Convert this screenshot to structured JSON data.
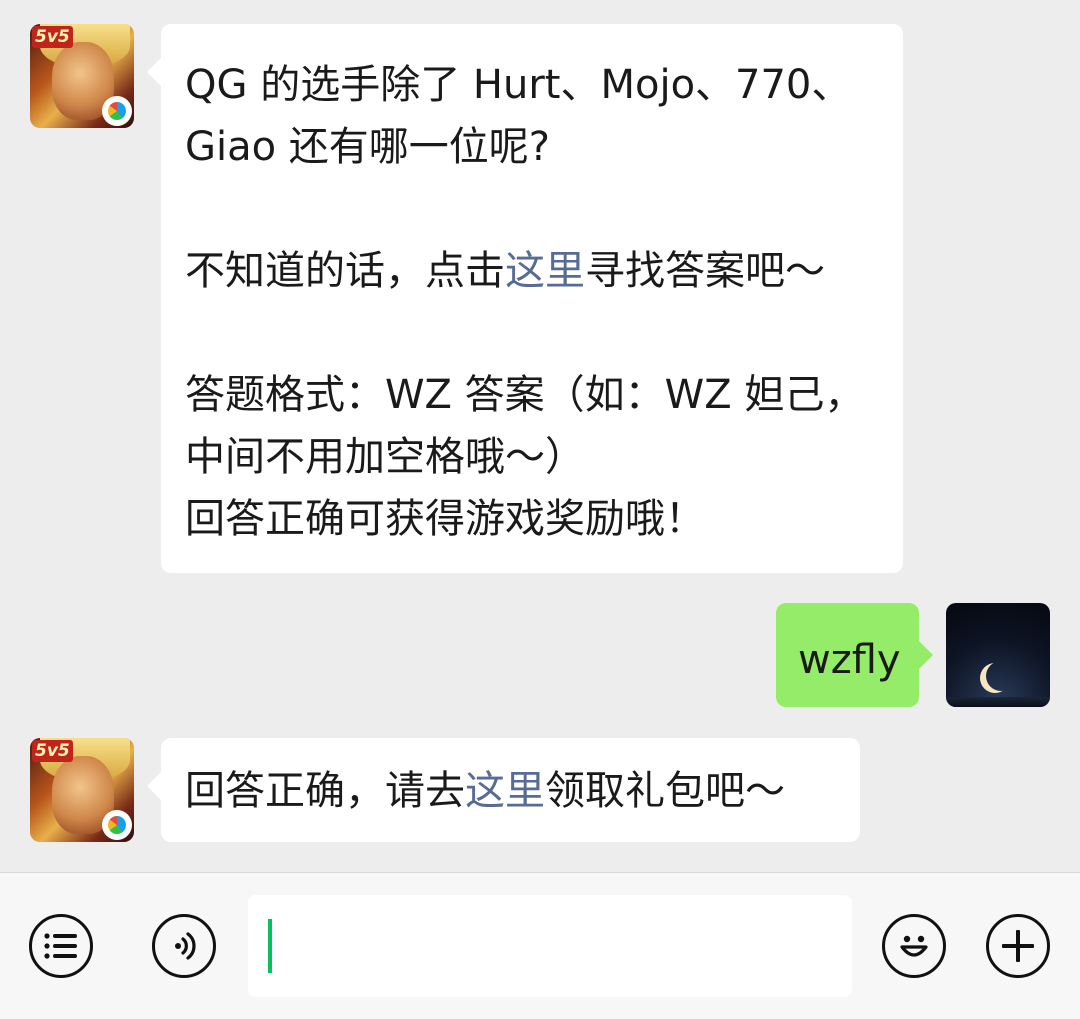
{
  "messages": [
    {
      "sender": "official",
      "lines": [
        "QG 的选手除了 Hurt、Mojo、770、",
        "Giao 还有哪一位呢?",
        "",
        [
          "不知道的话，点击",
          "这里",
          "寻找答案吧～"
        ],
        "",
        "答题格式：WZ 答案（如：WZ 妲己，",
        "中间不用加空格哦～）",
        "回答正确可获得游戏奖励哦！"
      ]
    },
    {
      "sender": "user",
      "text": "wzfly"
    },
    {
      "sender": "official",
      "parts": [
        "回答正确，请去",
        "这里",
        "领取礼包吧～"
      ]
    }
  ],
  "avatar": {
    "official_badge": "5v5"
  },
  "input_bar": {
    "value": ""
  },
  "colors": {
    "background": "#ededed",
    "bubble_incoming": "#ffffff",
    "bubble_outgoing": "#95ec69",
    "link": "#576b95",
    "caret": "#07c160"
  },
  "icons": {
    "menu": "list-icon",
    "voice": "voice-icon",
    "emoji": "smiley-icon",
    "more": "plus-icon"
  }
}
